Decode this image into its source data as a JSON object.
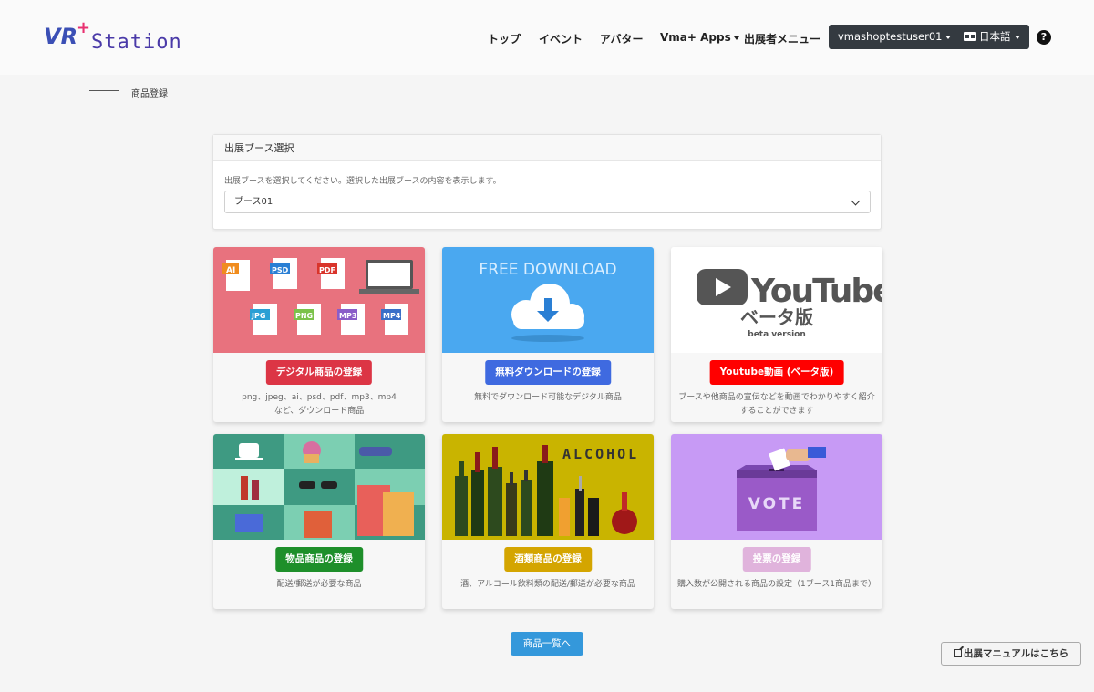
{
  "header": {
    "logo_prefix": "VR",
    "logo_plus": "+",
    "logo_suffix": "Station",
    "nav": [
      "トップ",
      "イベント",
      "アバター",
      "Vma+ Apps",
      "出展者メニュー"
    ],
    "user_button": "vmashoptestuser01",
    "lang_button": "日本語",
    "help": "?"
  },
  "breadcrumb": {
    "current": "商品登録"
  },
  "booth": {
    "title": "出展ブース選択",
    "description": "出展ブースを選択してください。選択した出展ブースの内容を表示します。",
    "selected": "ブース01"
  },
  "tiles": [
    {
      "button": "デジタル商品の登録",
      "desc_line1": "png、jpeg、ai、psd、pdf、mp3、mp4",
      "desc_line2": "など、ダウンロード商品",
      "color": "#dc3545",
      "icons": [
        "AI",
        "PSD",
        "PDF",
        "JPG",
        "PNG",
        "MP3",
        "MP4"
      ]
    },
    {
      "button": "無料ダウンロードの登録",
      "desc_line1": "無料でダウンロード可能なデジタル商品",
      "desc_line2": "",
      "color": "#3f6ae0",
      "banner": "FREE DOWNLOAD"
    },
    {
      "button": "Youtube動画 (ベータ版)",
      "desc_line1": "ブースや他商品の宣伝などを動画でわかりやすく紹介",
      "desc_line2": "することができます",
      "color": "#ff0000",
      "banner": "YouTube",
      "sub": "ベータ版",
      "sub2": "beta version"
    },
    {
      "button": "物品商品の登録",
      "desc_line1": "配送/郵送が必要な商品",
      "desc_line2": "",
      "color": "#1e8f2a"
    },
    {
      "button": "酒類商品の登録",
      "desc_line1": "酒、アルコール飲料類の配送/郵送が必要な商品",
      "desc_line2": "",
      "color": "#d4a500",
      "banner": "ALCOHOL"
    },
    {
      "button": "投票の登録",
      "desc_line1": "購入数が公開される商品の設定（1ブース1商品まで）",
      "desc_line2": "",
      "color": "#e0b3dc",
      "banner": "VOTE"
    }
  ],
  "list_button": "商品一覧へ",
  "manual_button": "出展マニュアルはこちら"
}
